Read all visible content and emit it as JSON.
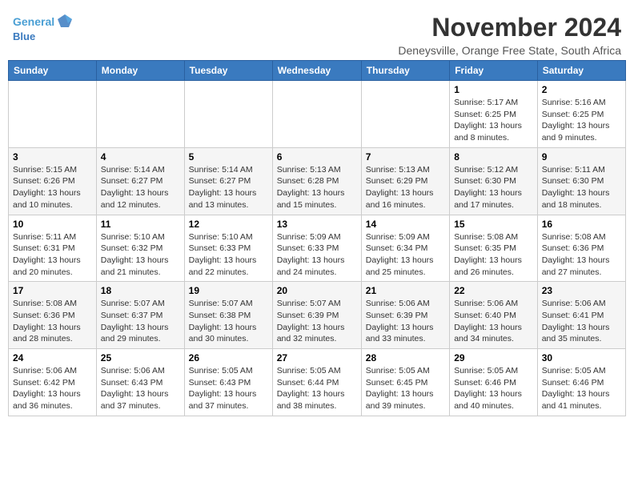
{
  "header": {
    "logo_line1": "General",
    "logo_line2": "Blue",
    "month": "November 2024",
    "location": "Deneysville, Orange Free State, South Africa"
  },
  "weekdays": [
    "Sunday",
    "Monday",
    "Tuesday",
    "Wednesday",
    "Thursday",
    "Friday",
    "Saturday"
  ],
  "weeks": [
    [
      {
        "day": "",
        "info": ""
      },
      {
        "day": "",
        "info": ""
      },
      {
        "day": "",
        "info": ""
      },
      {
        "day": "",
        "info": ""
      },
      {
        "day": "",
        "info": ""
      },
      {
        "day": "1",
        "info": "Sunrise: 5:17 AM\nSunset: 6:25 PM\nDaylight: 13 hours and 8 minutes."
      },
      {
        "day": "2",
        "info": "Sunrise: 5:16 AM\nSunset: 6:25 PM\nDaylight: 13 hours and 9 minutes."
      }
    ],
    [
      {
        "day": "3",
        "info": "Sunrise: 5:15 AM\nSunset: 6:26 PM\nDaylight: 13 hours and 10 minutes."
      },
      {
        "day": "4",
        "info": "Sunrise: 5:14 AM\nSunset: 6:27 PM\nDaylight: 13 hours and 12 minutes."
      },
      {
        "day": "5",
        "info": "Sunrise: 5:14 AM\nSunset: 6:27 PM\nDaylight: 13 hours and 13 minutes."
      },
      {
        "day": "6",
        "info": "Sunrise: 5:13 AM\nSunset: 6:28 PM\nDaylight: 13 hours and 15 minutes."
      },
      {
        "day": "7",
        "info": "Sunrise: 5:13 AM\nSunset: 6:29 PM\nDaylight: 13 hours and 16 minutes."
      },
      {
        "day": "8",
        "info": "Sunrise: 5:12 AM\nSunset: 6:30 PM\nDaylight: 13 hours and 17 minutes."
      },
      {
        "day": "9",
        "info": "Sunrise: 5:11 AM\nSunset: 6:30 PM\nDaylight: 13 hours and 18 minutes."
      }
    ],
    [
      {
        "day": "10",
        "info": "Sunrise: 5:11 AM\nSunset: 6:31 PM\nDaylight: 13 hours and 20 minutes."
      },
      {
        "day": "11",
        "info": "Sunrise: 5:10 AM\nSunset: 6:32 PM\nDaylight: 13 hours and 21 minutes."
      },
      {
        "day": "12",
        "info": "Sunrise: 5:10 AM\nSunset: 6:33 PM\nDaylight: 13 hours and 22 minutes."
      },
      {
        "day": "13",
        "info": "Sunrise: 5:09 AM\nSunset: 6:33 PM\nDaylight: 13 hours and 24 minutes."
      },
      {
        "day": "14",
        "info": "Sunrise: 5:09 AM\nSunset: 6:34 PM\nDaylight: 13 hours and 25 minutes."
      },
      {
        "day": "15",
        "info": "Sunrise: 5:08 AM\nSunset: 6:35 PM\nDaylight: 13 hours and 26 minutes."
      },
      {
        "day": "16",
        "info": "Sunrise: 5:08 AM\nSunset: 6:36 PM\nDaylight: 13 hours and 27 minutes."
      }
    ],
    [
      {
        "day": "17",
        "info": "Sunrise: 5:08 AM\nSunset: 6:36 PM\nDaylight: 13 hours and 28 minutes."
      },
      {
        "day": "18",
        "info": "Sunrise: 5:07 AM\nSunset: 6:37 PM\nDaylight: 13 hours and 29 minutes."
      },
      {
        "day": "19",
        "info": "Sunrise: 5:07 AM\nSunset: 6:38 PM\nDaylight: 13 hours and 30 minutes."
      },
      {
        "day": "20",
        "info": "Sunrise: 5:07 AM\nSunset: 6:39 PM\nDaylight: 13 hours and 32 minutes."
      },
      {
        "day": "21",
        "info": "Sunrise: 5:06 AM\nSunset: 6:39 PM\nDaylight: 13 hours and 33 minutes."
      },
      {
        "day": "22",
        "info": "Sunrise: 5:06 AM\nSunset: 6:40 PM\nDaylight: 13 hours and 34 minutes."
      },
      {
        "day": "23",
        "info": "Sunrise: 5:06 AM\nSunset: 6:41 PM\nDaylight: 13 hours and 35 minutes."
      }
    ],
    [
      {
        "day": "24",
        "info": "Sunrise: 5:06 AM\nSunset: 6:42 PM\nDaylight: 13 hours and 36 minutes."
      },
      {
        "day": "25",
        "info": "Sunrise: 5:06 AM\nSunset: 6:43 PM\nDaylight: 13 hours and 37 minutes."
      },
      {
        "day": "26",
        "info": "Sunrise: 5:05 AM\nSunset: 6:43 PM\nDaylight: 13 hours and 37 minutes."
      },
      {
        "day": "27",
        "info": "Sunrise: 5:05 AM\nSunset: 6:44 PM\nDaylight: 13 hours and 38 minutes."
      },
      {
        "day": "28",
        "info": "Sunrise: 5:05 AM\nSunset: 6:45 PM\nDaylight: 13 hours and 39 minutes."
      },
      {
        "day": "29",
        "info": "Sunrise: 5:05 AM\nSunset: 6:46 PM\nDaylight: 13 hours and 40 minutes."
      },
      {
        "day": "30",
        "info": "Sunrise: 5:05 AM\nSunset: 6:46 PM\nDaylight: 13 hours and 41 minutes."
      }
    ]
  ]
}
